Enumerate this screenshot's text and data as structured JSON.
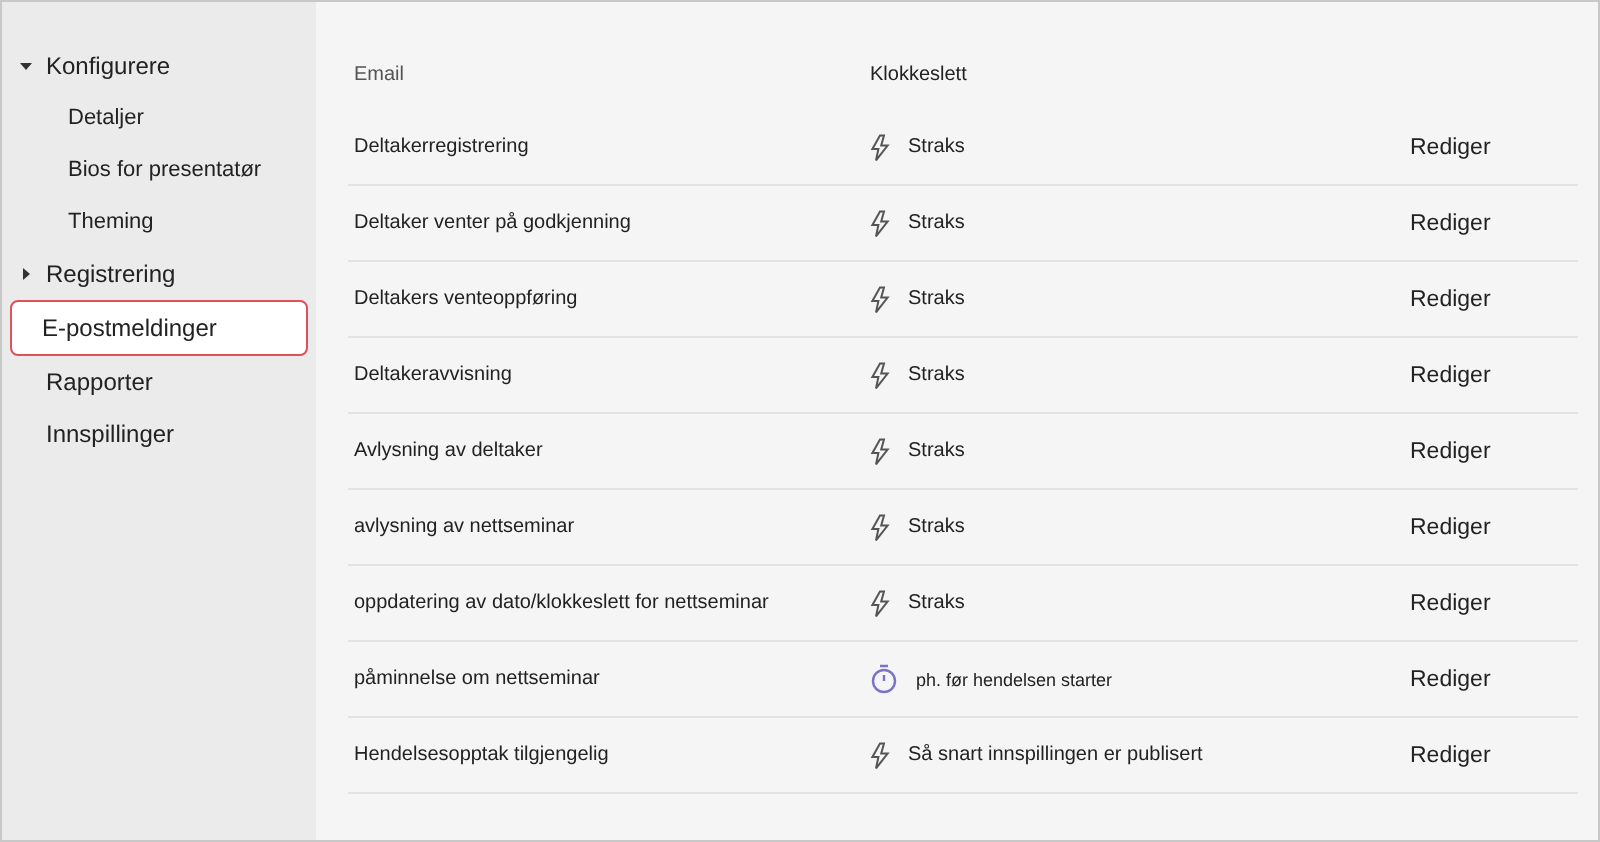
{
  "sidebar": {
    "items": [
      {
        "label": "Konfigurere",
        "expanded": true,
        "selected": false,
        "children": [
          {
            "label": "Detaljer",
            "selected": false
          },
          {
            "label": "Bios for presentatør",
            "selected": false
          },
          {
            "label": "Theming",
            "selected": false
          }
        ]
      },
      {
        "label": "Registrering",
        "expanded": false,
        "selected": false
      },
      {
        "label": "E-postmeldinger",
        "selected": true
      },
      {
        "label": "Rapporter",
        "selected": false
      },
      {
        "label": "Innspillinger",
        "selected": false
      }
    ]
  },
  "table": {
    "columns": [
      "Email",
      "Klokkeslett"
    ],
    "rows": [
      {
        "email": "Deltakerregistrering",
        "kind": "instant",
        "time": "Straks",
        "action": "Rediger"
      },
      {
        "email": "Deltaker venter på godkjenning",
        "kind": "instant",
        "time": "Straks",
        "action": "Rediger"
      },
      {
        "email": "Deltakers venteoppføring",
        "kind": "instant",
        "time": "Straks",
        "action": "Rediger"
      },
      {
        "email": "Deltakeravvisning",
        "kind": "instant",
        "time": "Straks",
        "action": "Rediger"
      },
      {
        "email": "Avlysning av deltaker",
        "kind": "instant",
        "time": "Straks",
        "action": "Rediger"
      },
      {
        "email": "avlysning av nettseminar",
        "kind": "instant",
        "time": "Straks",
        "action": "Rediger"
      },
      {
        "email": "oppdatering av dato/klokkeslett for nettseminar",
        "kind": "instant",
        "time": "Straks",
        "action": "Rediger"
      },
      {
        "email": "påminnelse om nettseminar",
        "kind": "timer",
        "time": "ph. før hendelsen starter",
        "action": "Rediger"
      },
      {
        "email": "Hendelsesopptak tilgjengelig",
        "kind": "instant",
        "time": "Så snart innspillingen er publisert",
        "action": "Rediger"
      }
    ]
  }
}
